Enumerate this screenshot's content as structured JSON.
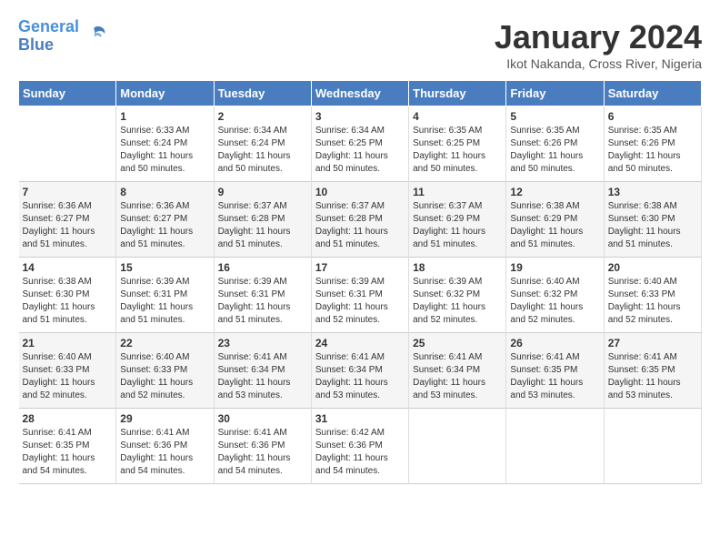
{
  "header": {
    "logo_line1": "General",
    "logo_line2": "Blue",
    "month_title": "January 2024",
    "location": "Ikot Nakanda, Cross River, Nigeria"
  },
  "weekdays": [
    "Sunday",
    "Monday",
    "Tuesday",
    "Wednesday",
    "Thursday",
    "Friday",
    "Saturday"
  ],
  "weeks": [
    [
      {
        "day": "",
        "info": ""
      },
      {
        "day": "1",
        "info": "Sunrise: 6:33 AM\nSunset: 6:24 PM\nDaylight: 11 hours\nand 50 minutes."
      },
      {
        "day": "2",
        "info": "Sunrise: 6:34 AM\nSunset: 6:24 PM\nDaylight: 11 hours\nand 50 minutes."
      },
      {
        "day": "3",
        "info": "Sunrise: 6:34 AM\nSunset: 6:25 PM\nDaylight: 11 hours\nand 50 minutes."
      },
      {
        "day": "4",
        "info": "Sunrise: 6:35 AM\nSunset: 6:25 PM\nDaylight: 11 hours\nand 50 minutes."
      },
      {
        "day": "5",
        "info": "Sunrise: 6:35 AM\nSunset: 6:26 PM\nDaylight: 11 hours\nand 50 minutes."
      },
      {
        "day": "6",
        "info": "Sunrise: 6:35 AM\nSunset: 6:26 PM\nDaylight: 11 hours\nand 50 minutes."
      }
    ],
    [
      {
        "day": "7",
        "info": "Sunrise: 6:36 AM\nSunset: 6:27 PM\nDaylight: 11 hours\nand 51 minutes."
      },
      {
        "day": "8",
        "info": "Sunrise: 6:36 AM\nSunset: 6:27 PM\nDaylight: 11 hours\nand 51 minutes."
      },
      {
        "day": "9",
        "info": "Sunrise: 6:37 AM\nSunset: 6:28 PM\nDaylight: 11 hours\nand 51 minutes."
      },
      {
        "day": "10",
        "info": "Sunrise: 6:37 AM\nSunset: 6:28 PM\nDaylight: 11 hours\nand 51 minutes."
      },
      {
        "day": "11",
        "info": "Sunrise: 6:37 AM\nSunset: 6:29 PM\nDaylight: 11 hours\nand 51 minutes."
      },
      {
        "day": "12",
        "info": "Sunrise: 6:38 AM\nSunset: 6:29 PM\nDaylight: 11 hours\nand 51 minutes."
      },
      {
        "day": "13",
        "info": "Sunrise: 6:38 AM\nSunset: 6:30 PM\nDaylight: 11 hours\nand 51 minutes."
      }
    ],
    [
      {
        "day": "14",
        "info": "Sunrise: 6:38 AM\nSunset: 6:30 PM\nDaylight: 11 hours\nand 51 minutes."
      },
      {
        "day": "15",
        "info": "Sunrise: 6:39 AM\nSunset: 6:31 PM\nDaylight: 11 hours\nand 51 minutes."
      },
      {
        "day": "16",
        "info": "Sunrise: 6:39 AM\nSunset: 6:31 PM\nDaylight: 11 hours\nand 51 minutes."
      },
      {
        "day": "17",
        "info": "Sunrise: 6:39 AM\nSunset: 6:31 PM\nDaylight: 11 hours\nand 52 minutes."
      },
      {
        "day": "18",
        "info": "Sunrise: 6:39 AM\nSunset: 6:32 PM\nDaylight: 11 hours\nand 52 minutes."
      },
      {
        "day": "19",
        "info": "Sunrise: 6:40 AM\nSunset: 6:32 PM\nDaylight: 11 hours\nand 52 minutes."
      },
      {
        "day": "20",
        "info": "Sunrise: 6:40 AM\nSunset: 6:33 PM\nDaylight: 11 hours\nand 52 minutes."
      }
    ],
    [
      {
        "day": "21",
        "info": "Sunrise: 6:40 AM\nSunset: 6:33 PM\nDaylight: 11 hours\nand 52 minutes."
      },
      {
        "day": "22",
        "info": "Sunrise: 6:40 AM\nSunset: 6:33 PM\nDaylight: 11 hours\nand 52 minutes."
      },
      {
        "day": "23",
        "info": "Sunrise: 6:41 AM\nSunset: 6:34 PM\nDaylight: 11 hours\nand 53 minutes."
      },
      {
        "day": "24",
        "info": "Sunrise: 6:41 AM\nSunset: 6:34 PM\nDaylight: 11 hours\nand 53 minutes."
      },
      {
        "day": "25",
        "info": "Sunrise: 6:41 AM\nSunset: 6:34 PM\nDaylight: 11 hours\nand 53 minutes."
      },
      {
        "day": "26",
        "info": "Sunrise: 6:41 AM\nSunset: 6:35 PM\nDaylight: 11 hours\nand 53 minutes."
      },
      {
        "day": "27",
        "info": "Sunrise: 6:41 AM\nSunset: 6:35 PM\nDaylight: 11 hours\nand 53 minutes."
      }
    ],
    [
      {
        "day": "28",
        "info": "Sunrise: 6:41 AM\nSunset: 6:35 PM\nDaylight: 11 hours\nand 54 minutes."
      },
      {
        "day": "29",
        "info": "Sunrise: 6:41 AM\nSunset: 6:36 PM\nDaylight: 11 hours\nand 54 minutes."
      },
      {
        "day": "30",
        "info": "Sunrise: 6:41 AM\nSunset: 6:36 PM\nDaylight: 11 hours\nand 54 minutes."
      },
      {
        "day": "31",
        "info": "Sunrise: 6:42 AM\nSunset: 6:36 PM\nDaylight: 11 hours\nand 54 minutes."
      },
      {
        "day": "",
        "info": ""
      },
      {
        "day": "",
        "info": ""
      },
      {
        "day": "",
        "info": ""
      }
    ]
  ]
}
